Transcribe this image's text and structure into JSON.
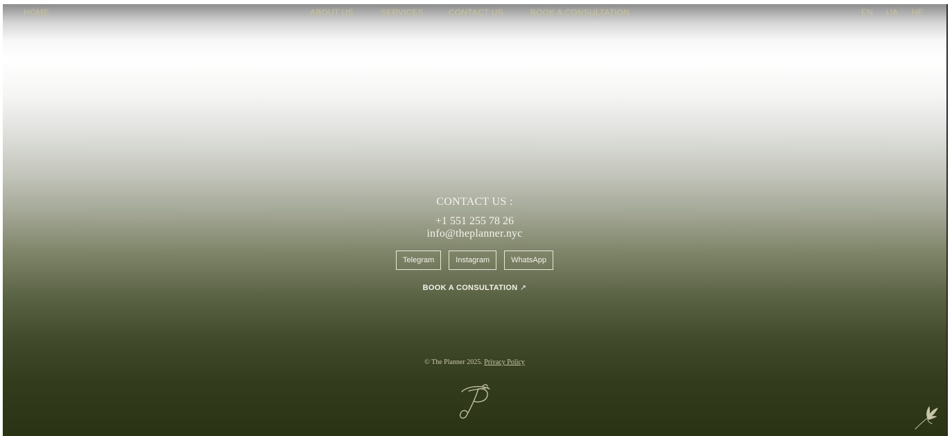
{
  "nav": {
    "home": "HOME",
    "about": "ABOUT US",
    "services": "SERVICES",
    "contact": "CONTACT US",
    "book": "BOOK A CONSULTATION",
    "languages": [
      "EN",
      "UA",
      "HE"
    ]
  },
  "contact": {
    "title": "CONTACT US :",
    "phone": "+1 551 255 78 26",
    "email": "info@theplanner.nyc"
  },
  "socials": [
    "Telegram",
    "Instagram",
    "WhatsApp"
  ],
  "book_cta": {
    "label": "BOOK A CONSULTATION",
    "arrow": "↗"
  },
  "footer": {
    "copyright": "© The Planner 2025.",
    "privacy": "Privacy Policy"
  },
  "icons": {
    "logo": "monogram-tp-icon",
    "bird": "bird-icon",
    "arrow": "arrow-up-right-icon"
  },
  "colors": {
    "nav_text": "#c7c397",
    "accent_text": "#f4f3ea",
    "footer_text": "#c9c7a9",
    "bottom_green": "#2a3414"
  }
}
